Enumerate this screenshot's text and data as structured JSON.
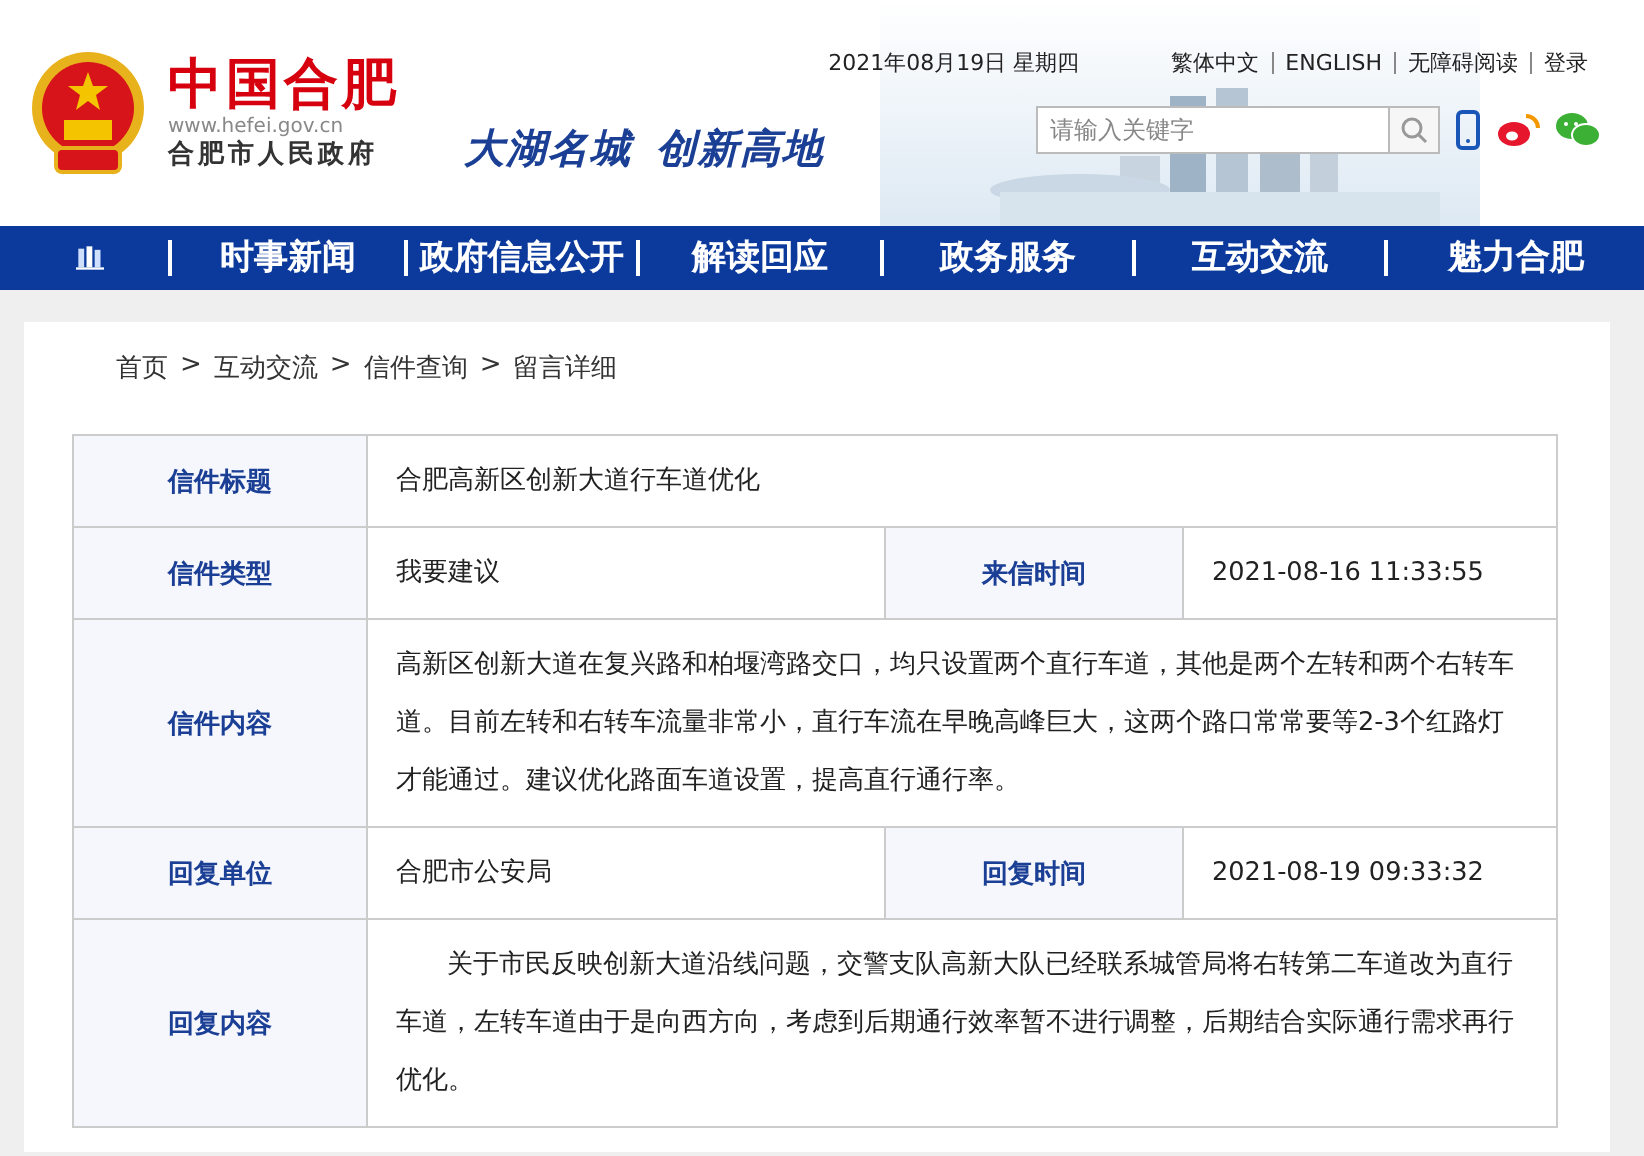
{
  "header": {
    "site_name": "中国合肥",
    "site_url": "www.hefei.gov.cn",
    "site_subtitle": "合肥市人民政府",
    "slogans": [
      "大湖名城",
      "创新高地"
    ],
    "date": "2021年08月19日 星期四",
    "top_links": [
      "繁体中文",
      "ENGLISH",
      "无障碍阅读",
      "登录"
    ],
    "search": {
      "placeholder": "请输入关键字"
    }
  },
  "nav": {
    "items": [
      "时事新闻",
      "政府信息公开",
      "解读回应",
      "政务服务",
      "互动交流",
      "魅力合肥"
    ]
  },
  "breadcrumb": {
    "separator": ">",
    "items": [
      "首页",
      "互动交流",
      "信件查询",
      "留言详细"
    ]
  },
  "letter": {
    "rows": [
      {
        "kind": "single",
        "label": "信件标题",
        "value": "合肥高新区创新大道行车道优化"
      },
      {
        "kind": "pair",
        "label": "信件类型",
        "value": "我要建议",
        "label2": "来信时间",
        "value2": "2021-08-16 11:33:55"
      },
      {
        "kind": "paragraph",
        "label": "信件内容",
        "value": "高新区创新大道在复兴路和柏堰湾路交口，均只设置两个直行车道，其他是两个左转和两个右转车道。目前左转和右转车流量非常小，直行车流在早晚高峰巨大，这两个路口常常要等2-3个红路灯才能通过。建议优化路面车道设置，提高直行通行率。"
      },
      {
        "kind": "pair",
        "label": "回复单位",
        "value": "合肥市公安局",
        "label2": "回复时间",
        "value2": "2021-08-19 09:33:32"
      },
      {
        "kind": "indented",
        "label": "回复内容",
        "value": "关于市民反映创新大道沿线问题，交警支队高新大队已经联系城管局将右转第二车道改为直行车道，左转车道由于是向西方向，考虑到后期通行效率暂不进行调整，后期结合实际通行需求再行优化。"
      }
    ]
  }
}
